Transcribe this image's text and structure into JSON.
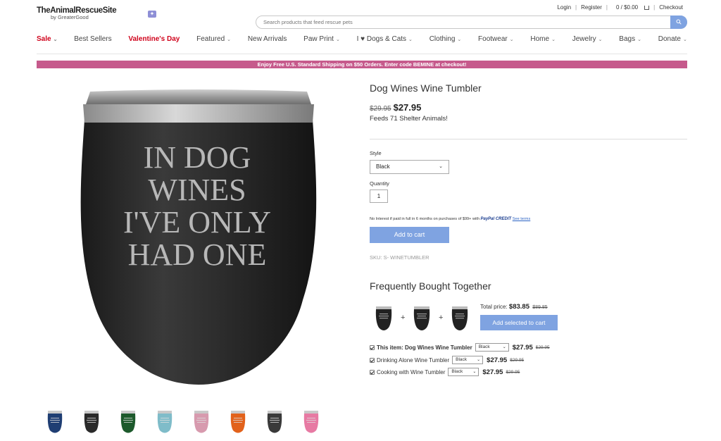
{
  "header": {
    "logo_text": "TheAnimalRescueSite",
    "logo_sub": "by GreaterGood",
    "login": "Login",
    "register": "Register",
    "cart": "0 / $0.00",
    "checkout": "Checkout",
    "search_placeholder": "Search products that feed rescue pets"
  },
  "nav": [
    {
      "label": "Sale",
      "chevron": true
    },
    {
      "label": "Best Sellers",
      "chevron": false
    },
    {
      "label": "Valentine's Day",
      "chevron": false
    },
    {
      "label": "Featured",
      "chevron": true
    },
    {
      "label": "New Arrivals",
      "chevron": false
    },
    {
      "label": "Paw Print",
      "chevron": true
    },
    {
      "label": "I ♥ Dogs & Cats",
      "chevron": true
    },
    {
      "label": "Clothing",
      "chevron": true
    },
    {
      "label": "Footwear",
      "chevron": true
    },
    {
      "label": "Home",
      "chevron": true
    },
    {
      "label": "Jewelry",
      "chevron": true
    },
    {
      "label": "Bags",
      "chevron": true
    },
    {
      "label": "Donate",
      "chevron": true
    }
  ],
  "promo": "Enjoy Free U.S. Standard Shipping on $50 Orders. Enter code BEMINE at checkout!",
  "product": {
    "title": "Dog Wines Wine Tumbler",
    "old_price": "$29.95",
    "price": "$27.95",
    "feeds": "Feeds 71 Shelter Animals!",
    "image_text": [
      "IN DOG",
      "WINES",
      "I'VE ONLY",
      "HAD ONE"
    ],
    "style_label": "Style",
    "style_value": "Black",
    "quantity_label": "Quantity",
    "quantity_value": "1",
    "paypal_text": "No Interest if paid in full in 6 months on purchases of $99+ with",
    "paypal_brand": "PayPal CREDIT",
    "paypal_link": "See terms",
    "add_to_cart": "Add to cart",
    "sku": "SKU: S- WINETUMBLER"
  },
  "thumbnails": [
    {
      "color": "#1f3e73"
    },
    {
      "color": "#2a2a2a"
    },
    {
      "color": "#1d5a2c"
    },
    {
      "color": "#7fbcc9"
    },
    {
      "color": "#d79aae"
    },
    {
      "color": "#e2621b"
    },
    {
      "color": "#3a3a3a"
    },
    {
      "color": "#e77aa3"
    }
  ],
  "fbt": {
    "title": "Frequently Bought Together",
    "total_label": "Total price:",
    "total_price": "$83.85",
    "total_old": "$89.85",
    "add_selected": "Add selected to cart",
    "items": [
      {
        "name": "This item: Dog Wines Wine Tumbler",
        "bold": true,
        "style": "Black",
        "price": "$27.95",
        "old": "$29.95"
      },
      {
        "name": "Drinking Alone Wine Tumbler",
        "bold": false,
        "style": "Black",
        "price": "$27.95",
        "old": "$29.95"
      },
      {
        "name": "Cooking with Wine Tumbler",
        "bold": false,
        "style": "Black",
        "price": "$27.95",
        "old": "$29.95"
      }
    ]
  }
}
